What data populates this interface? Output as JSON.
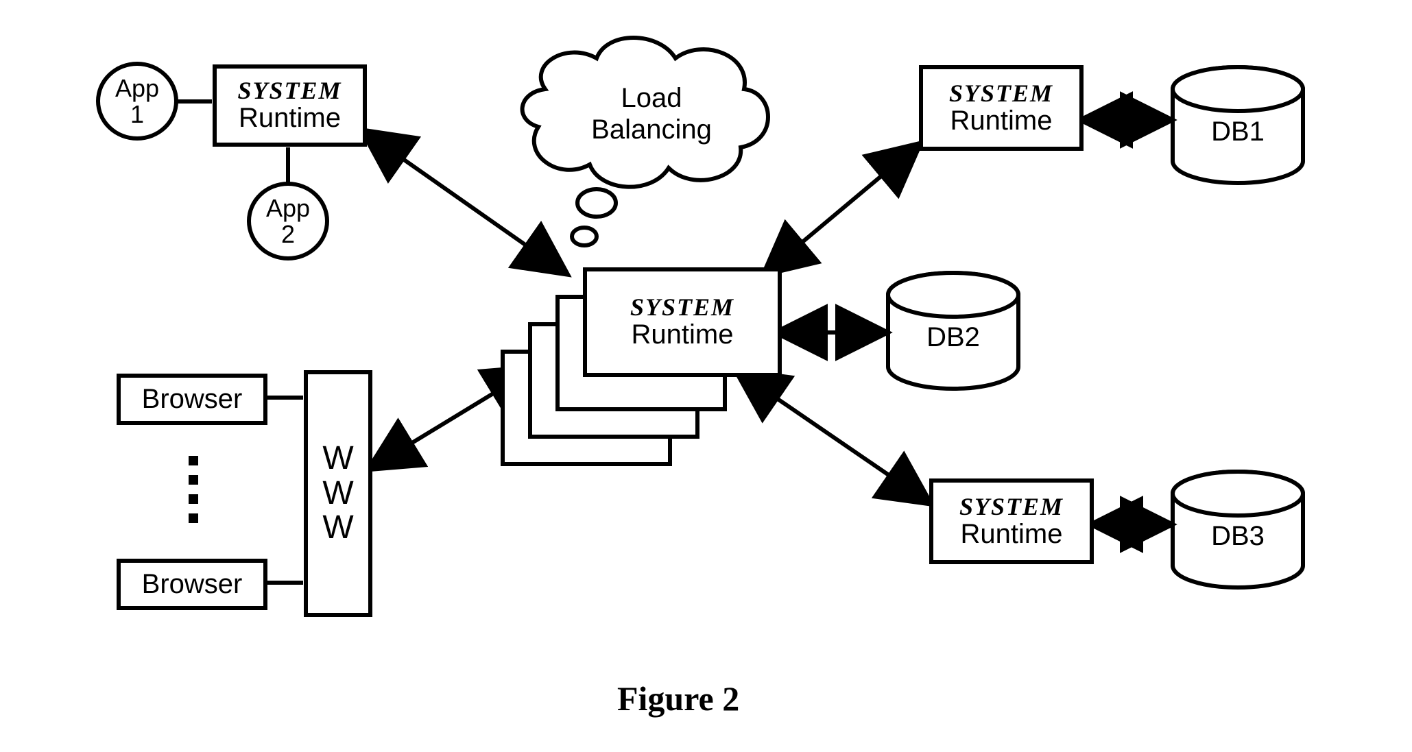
{
  "caption": "Figure 2",
  "nodes": {
    "app1": {
      "line1": "App",
      "line2": "1"
    },
    "app2": {
      "line1": "App",
      "line2": "2"
    },
    "runtime_left": {
      "system": "SYSTEM",
      "runtime": "Runtime"
    },
    "runtime_center": {
      "system": "SYSTEM",
      "runtime": "Runtime"
    },
    "runtime_right_top": {
      "system": "SYSTEM",
      "runtime": "Runtime"
    },
    "runtime_right_bottom": {
      "system": "SYSTEM",
      "runtime": "Runtime"
    },
    "cloud": {
      "line1": "Load",
      "line2": "Balancing"
    },
    "browser1": "Browser",
    "browser2": "Browser",
    "www": {
      "c1": "W",
      "c2": "W",
      "c3": "W"
    },
    "db1": "DB1",
    "db2": "DB2",
    "db3": "DB3"
  }
}
